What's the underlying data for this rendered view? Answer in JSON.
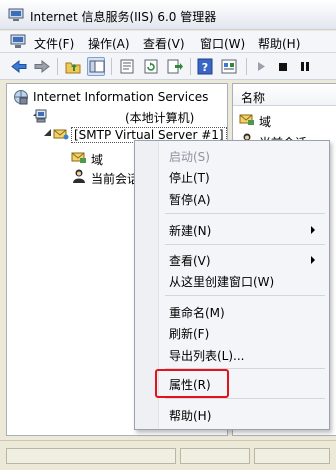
{
  "window": {
    "title": "Internet 信息服务(IIS) 6.0 管理器"
  },
  "menubar": {
    "items": [
      {
        "label": "文件(F)"
      },
      {
        "label": "操作(A)"
      },
      {
        "label": "查看(V)"
      },
      {
        "label": "窗口(W)"
      },
      {
        "label": "帮助(H)"
      }
    ]
  },
  "toolbar": {
    "buttons": [
      "back-icon",
      "forward-icon",
      "up-folder-icon",
      "show-tree-icon",
      "properties-icon",
      "refresh-icon",
      "export-icon",
      "help-icon",
      "mmc-icon",
      "play-icon",
      "stop-icon",
      "pause-icon"
    ]
  },
  "tree": {
    "root": "Internet Information Services",
    "computer": "(本地计算机)",
    "smtp": "[SMTP Virtual Server #1]",
    "domains": "域",
    "sessions": "当前会话"
  },
  "list": {
    "column_name": "名称",
    "items": [
      "域",
      "当前会话"
    ]
  },
  "context_menu": {
    "start": "启动(S)",
    "stop": "停止(T)",
    "pause": "暂停(A)",
    "new": "新建(N)",
    "view": "查看(V)",
    "new_window": "从这里创建窗口(W)",
    "rename": "重命名(M)",
    "refresh": "刷新(F)",
    "export": "导出列表(L)...",
    "properties": "属性(R)",
    "help": "帮助(H)"
  },
  "colors": {
    "highlight_box": "#e0141a",
    "menu_bg": "#f4f5f8"
  }
}
